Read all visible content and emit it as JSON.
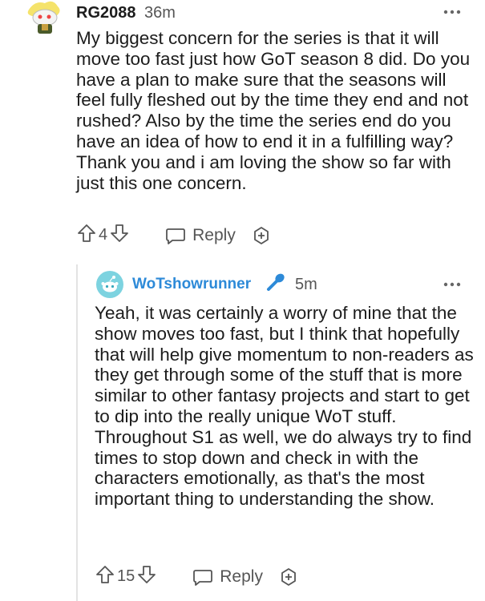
{
  "comment": {
    "username": "RG2088",
    "time": "36m",
    "text": "My biggest concern for the series is that it will move too fast just how GoT season 8 did. Do you have a plan to make sure that the seasons will feel fully fleshed out by the time they end and not rushed? Also by the time the series end do you have an idea of how to end it in a fulfilling way? Thank you and i am loving the show so far with just this one concern.",
    "votes": "4",
    "reply_label": "Reply"
  },
  "reply": {
    "username": "WoTshowrunner",
    "time": "5m",
    "text": "Yeah, it was certainly a worry of mine that the show moves too fast, but I think that hopefully that will help give momentum to non-readers as they get through some of the stuff that is more similar to other fantasy projects and start to get to dip into the really unique WoT stuff. Throughout S1 as well, we do always try to find times to stop down and check in with the characters emotionally, as that's the most important thing to understanding the show.",
    "votes": "15",
    "reply_label": "Reply"
  },
  "colors": {
    "username_accent": "#2d8ad8",
    "mic": "#2d8ad8",
    "thread_line": "#e3e3e3"
  }
}
